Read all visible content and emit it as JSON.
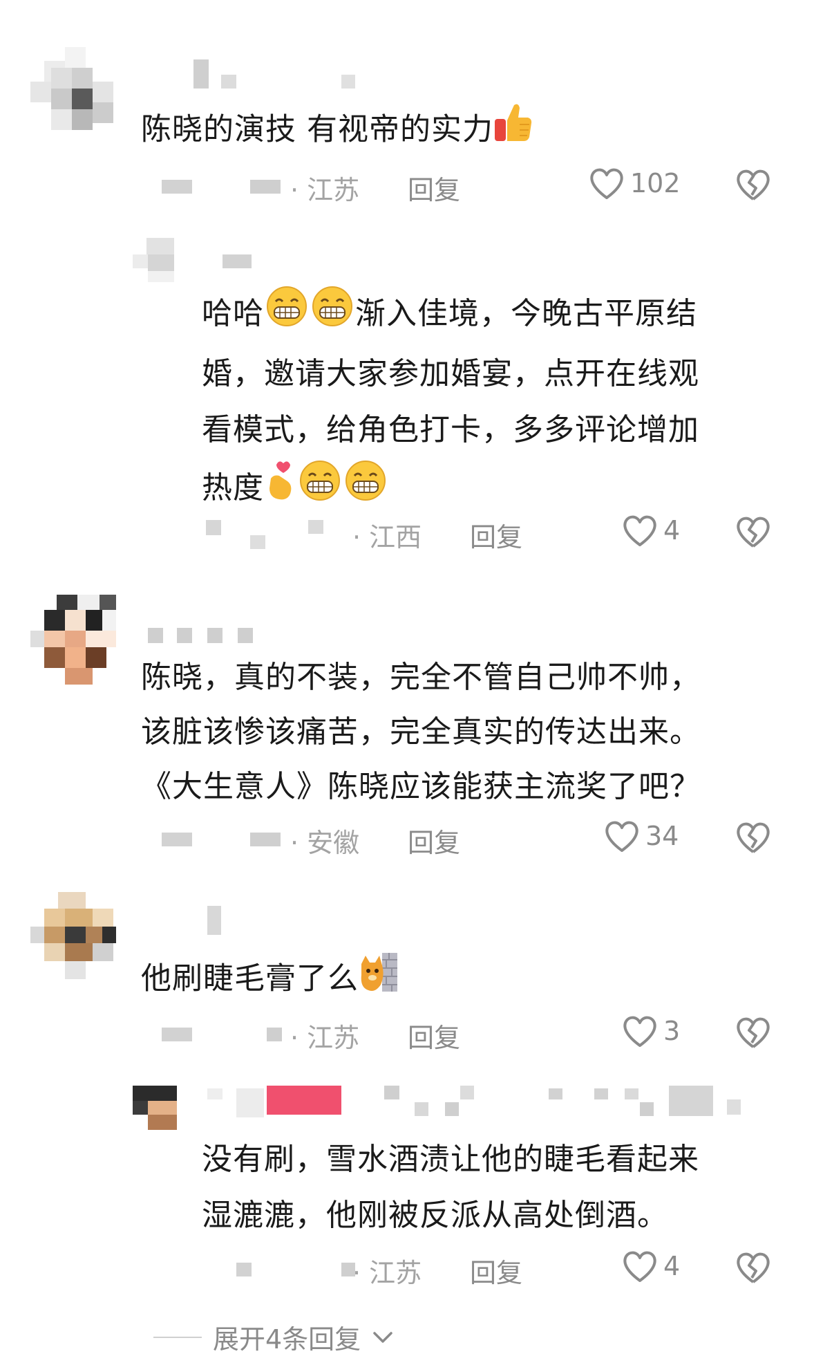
{
  "comments": [
    {
      "text": "陈晓的演技 有视帝的实力",
      "location": "· 江苏",
      "reply_label": "回复",
      "likes": "102",
      "emoji": "thumbs-up",
      "replies": [
        {
          "lines": [
            "哈哈",
            "渐入佳境，今晚古平原结",
            "婚，邀请大家参加婚宴，点开在线观",
            "看模式，给角色打卡，多多评论增加",
            "热度"
          ],
          "location": "· 江西",
          "reply_label": "回复",
          "likes": "4"
        }
      ]
    },
    {
      "lines": [
        "陈晓，真的不装，完全不管自己帅不帅，",
        "该脏该惨该痛苦，完全真实的传达出来。",
        "《大生意人》陈晓应该能获主流奖了吧？"
      ],
      "location": "· 安徽",
      "reply_label": "回复",
      "likes": "34"
    },
    {
      "text": "他刷睫毛膏了么",
      "location": "· 江苏",
      "reply_label": "回复",
      "likes": "3",
      "emoji": "cat-wall",
      "replies": [
        {
          "lines": [
            "没有刷，雪水酒渍让他的睫毛看起来",
            "湿漉漉，他刚被反派从高处倒酒。"
          ],
          "location": "· 江苏",
          "reply_label": "回复",
          "likes": "4"
        }
      ]
    }
  ],
  "expand_label": "展开4条回复",
  "colors": {
    "text": "#1a1a1a",
    "meta": "#8a8a8a",
    "location": "#a3a3a3",
    "highlight_blur": "#f0506e"
  }
}
